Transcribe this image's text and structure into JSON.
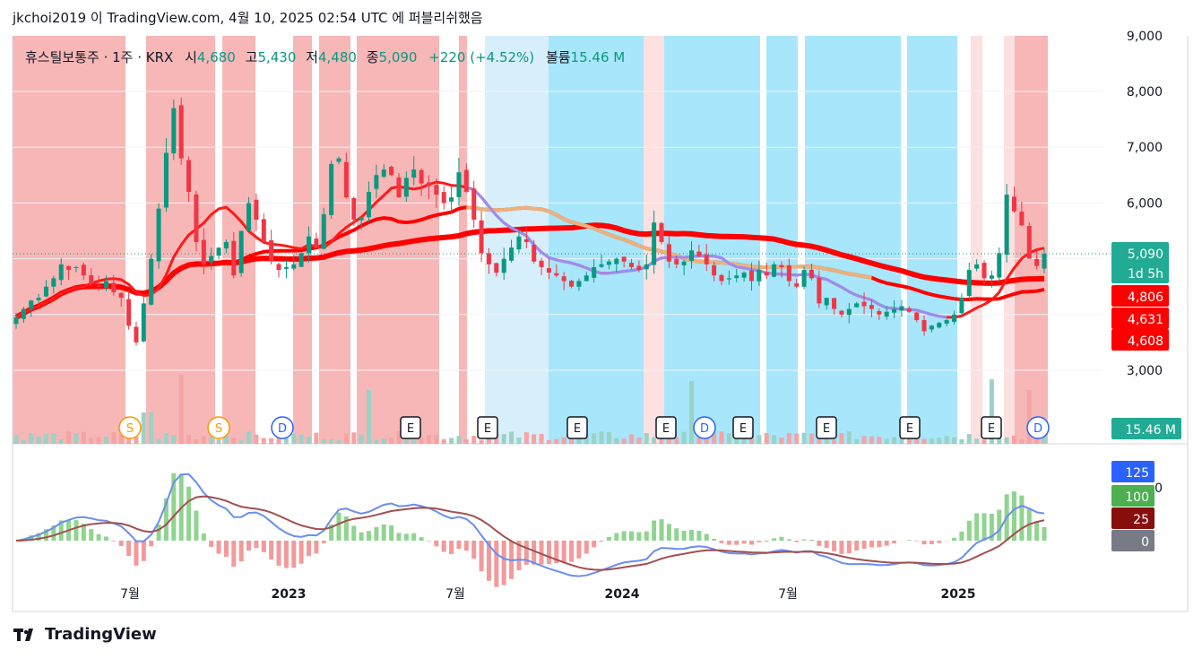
{
  "header": {
    "text": "jkchoi2019 이 TradingView.com, 4월 10, 2025 02:54 UTC 에 퍼블리쉬했음"
  },
  "legend": {
    "name": "휴스틸보통주 · 1주 · KRX",
    "open_label": "시",
    "open_value": "4,680",
    "high_label": "고",
    "high_value": "5,430",
    "low_label": "저",
    "low_value": "4,480",
    "close_label": "종",
    "close_value": "5,090",
    "change": "+220 (+4.52%)",
    "volume_label": "볼륨",
    "volume_value": "15.46 M"
  },
  "footer": {
    "brand": "TradingView"
  },
  "colors": {
    "up": "#089981",
    "down": "#f23645",
    "bg_red": "#f7b7b7",
    "bg_light_red": "#fde0e0",
    "bg_blue": "#a8e6fb",
    "bg_light_blue": "#d7effb",
    "ma_red": "#ff0000",
    "ma_purple": "#9b8cf2",
    "ma_tan": "#e8c58a",
    "macd_line": "#6b8df0",
    "signal_line": "#a05050",
    "hist_pos": "#8fd48f",
    "hist_neg": "#f29a9a"
  },
  "chart_data": [
    {
      "type": "candlestick",
      "x_ticks": [
        "7월",
        "2023",
        "7월",
        "2024",
        "7월",
        "2025"
      ],
      "y_ticks": [
        3000,
        4000,
        5000,
        6000,
        7000,
        8000,
        9000
      ],
      "y_tick_labels": [
        "3,000",
        "4,000",
        "5,000",
        "6,000",
        "7,000",
        "8,000",
        "9,000"
      ],
      "ylim": [
        2800,
        9000
      ],
      "weekly_close": [
        3950,
        4100,
        4250,
        4300,
        4500,
        4650,
        4900,
        4800,
        4850,
        4700,
        4550,
        4500,
        4600,
        4400,
        4300,
        3800,
        3500,
        4200,
        5000,
        5900,
        6900,
        7700,
        6800,
        6200,
        5300,
        4900,
        5050,
        5200,
        5300,
        4700,
        5500,
        6000,
        5700,
        5300,
        4950,
        4800,
        4850,
        4900,
        5100,
        5400,
        5200,
        5800,
        6700,
        6800,
        6100,
        5700,
        5750,
        6200,
        6500,
        6600,
        6500,
        6100,
        6450,
        6600,
        6350,
        6300,
        6150,
        6000,
        6100,
        6550,
        6200,
        5700,
        5100,
        4900,
        4750,
        5000,
        5200,
        5400,
        5300,
        4950,
        4850,
        4750,
        4700,
        4600,
        4500,
        4600,
        4700,
        4850,
        4900,
        4950,
        5000,
        4950,
        4850,
        4800,
        4900,
        5650,
        5300,
        4950,
        4900,
        4950,
        5150,
        5050,
        4900,
        4700,
        4600,
        4650,
        4700,
        4750,
        4600,
        4800,
        4700,
        4900,
        4850,
        4600,
        4500,
        4800,
        4650,
        4200,
        4300,
        4100,
        4000,
        4100,
        4200,
        4150,
        4100,
        4000,
        4050,
        4100,
        4150,
        4050,
        3900,
        3700,
        3800,
        3850,
        3900,
        4000,
        4300,
        4800,
        4900,
        4650,
        4700,
        5100,
        6150,
        5850,
        5600,
        5000,
        4870,
        5090
      ],
      "volume_labels": {
        "volume": "15.46 M"
      },
      "price_badges": [
        {
          "label": "5,090",
          "sub": "1d 5h",
          "value": 5090,
          "color": "#22ab94"
        },
        {
          "label": "4,806",
          "value": 4806,
          "color": "#ff0000"
        },
        {
          "label": "4,631",
          "value": 4631,
          "color": "#ff0000"
        },
        {
          "label": "4,608",
          "value": 4608,
          "color": "#ff0000"
        }
      ],
      "events": [
        {
          "label": "S",
          "type": "split",
          "color": "#ff9800"
        },
        {
          "label": "S",
          "type": "split",
          "color": "#ff9800"
        },
        {
          "label": "D",
          "type": "dividend",
          "color": "#2962ff"
        },
        {
          "label": "E",
          "type": "earnings",
          "color": "#131722"
        },
        {
          "label": "E",
          "type": "earnings",
          "color": "#131722"
        },
        {
          "label": "E",
          "type": "earnings",
          "color": "#131722"
        },
        {
          "label": "E",
          "type": "earnings",
          "color": "#131722"
        },
        {
          "label": "D",
          "type": "dividend",
          "color": "#2962ff"
        },
        {
          "label": "E",
          "type": "earnings",
          "color": "#131722"
        },
        {
          "label": "E",
          "type": "earnings",
          "color": "#131722"
        },
        {
          "label": "E",
          "type": "earnings",
          "color": "#131722"
        },
        {
          "label": "E",
          "type": "earnings",
          "color": "#131722"
        },
        {
          "label": "D",
          "type": "dividend",
          "color": "#2962ff"
        }
      ]
    },
    {
      "type": "macd",
      "badges": [
        {
          "label": "125",
          "color": "#2962ff"
        },
        {
          "label": "100",
          "color": "#4caf50"
        },
        {
          "label": "25",
          "color": "#880e0e"
        },
        {
          "label": "0",
          "color": "#787b86"
        }
      ],
      "axis_stub": "0"
    }
  ]
}
